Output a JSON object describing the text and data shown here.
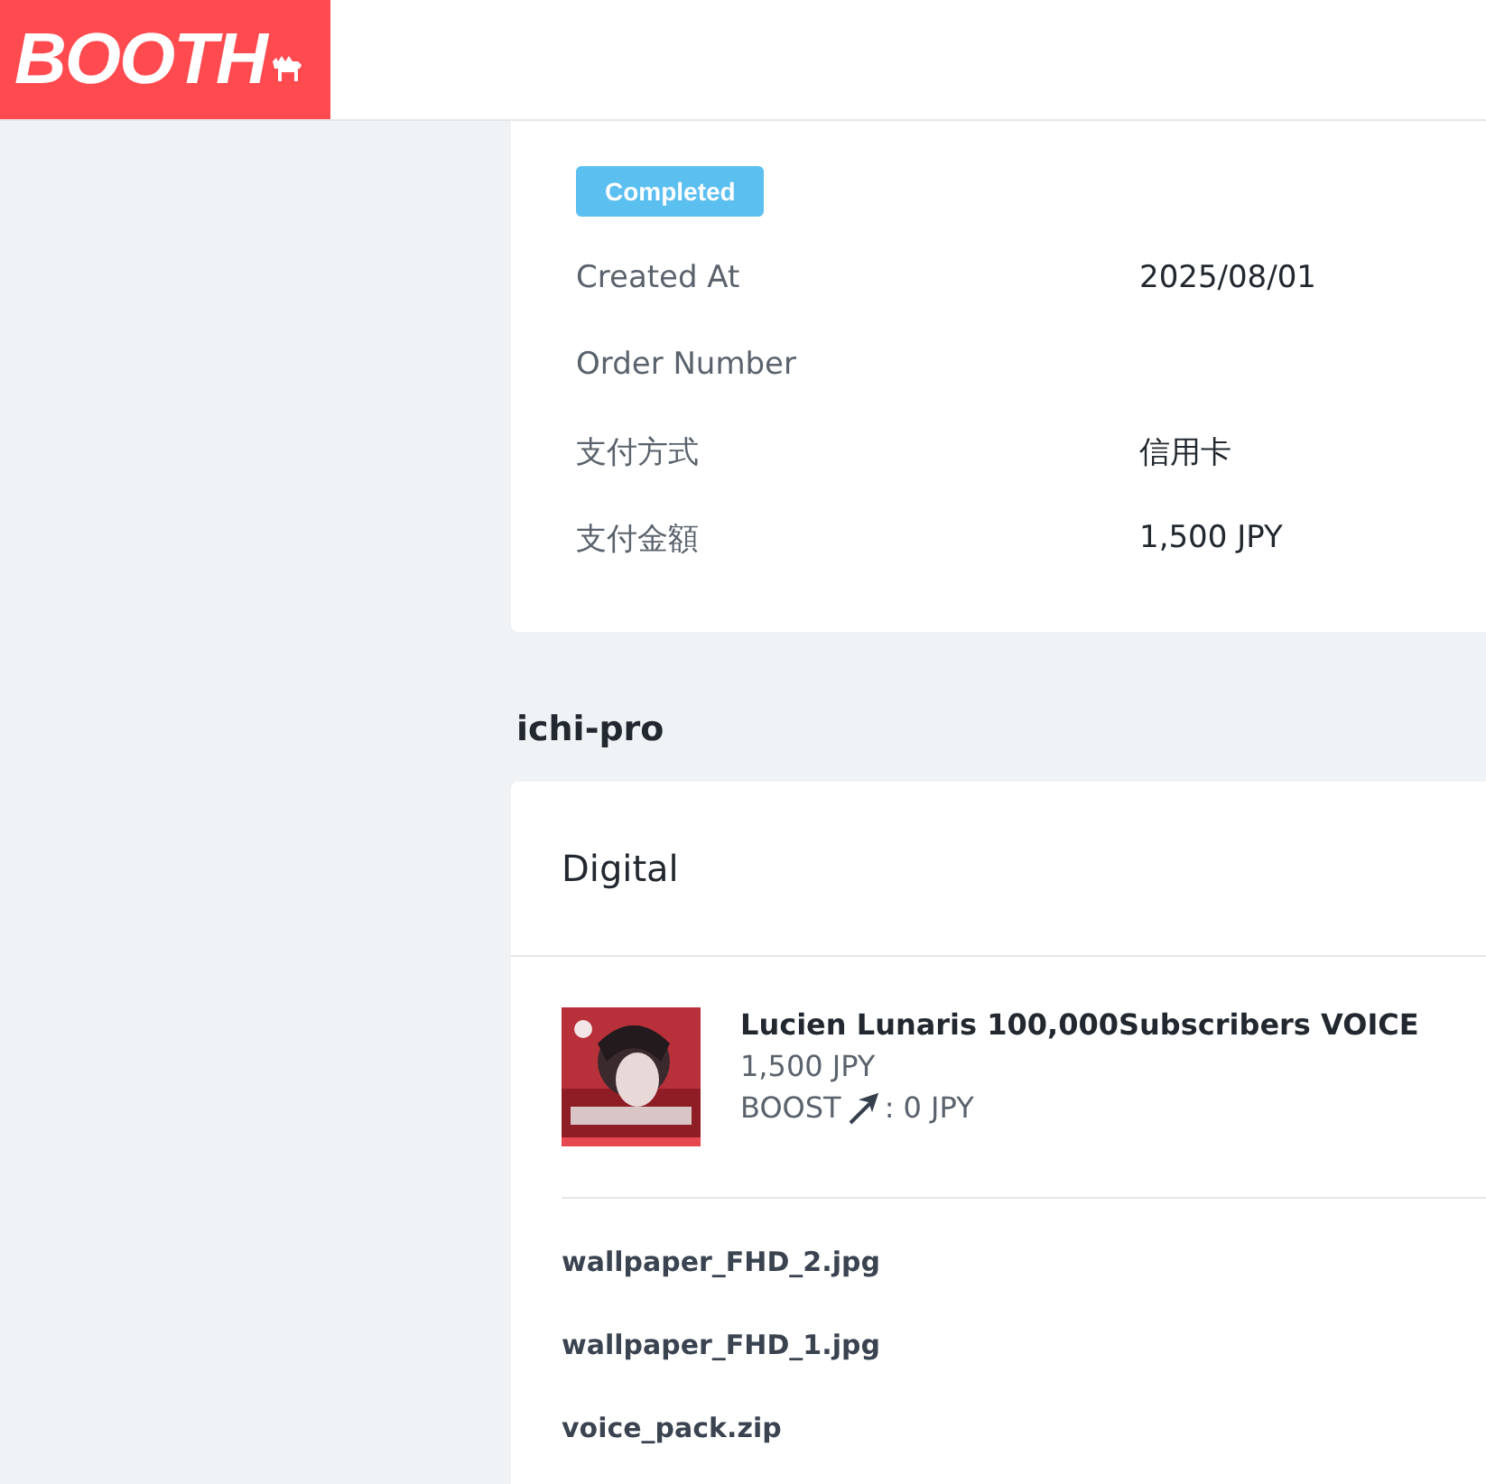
{
  "header": {
    "logo": "BOOTH"
  },
  "order": {
    "status": "Completed",
    "details": [
      {
        "label": "Created At",
        "value": "2025/08/01"
      },
      {
        "label": "Order Number"
      },
      {
        "label": "支付方式",
        "value": "信用卡"
      },
      {
        "label": "支付金額",
        "value": "1,500 JPY"
      }
    ]
  },
  "shop": {
    "name": "ichi-pro",
    "section": "Digital",
    "item": {
      "kind": "picture",
      "title": "Lucien Lunaris 100,000Subscribers VOICE",
      "price": "1,500 JPY",
      "boost_label": "BOOST",
      "boost_value": ": 0 JPY"
    },
    "files": [
      "wallpaper_FHD_2.jpg",
      "wallpaper_FHD_1.jpg",
      "voice_pack.zip"
    ]
  }
}
